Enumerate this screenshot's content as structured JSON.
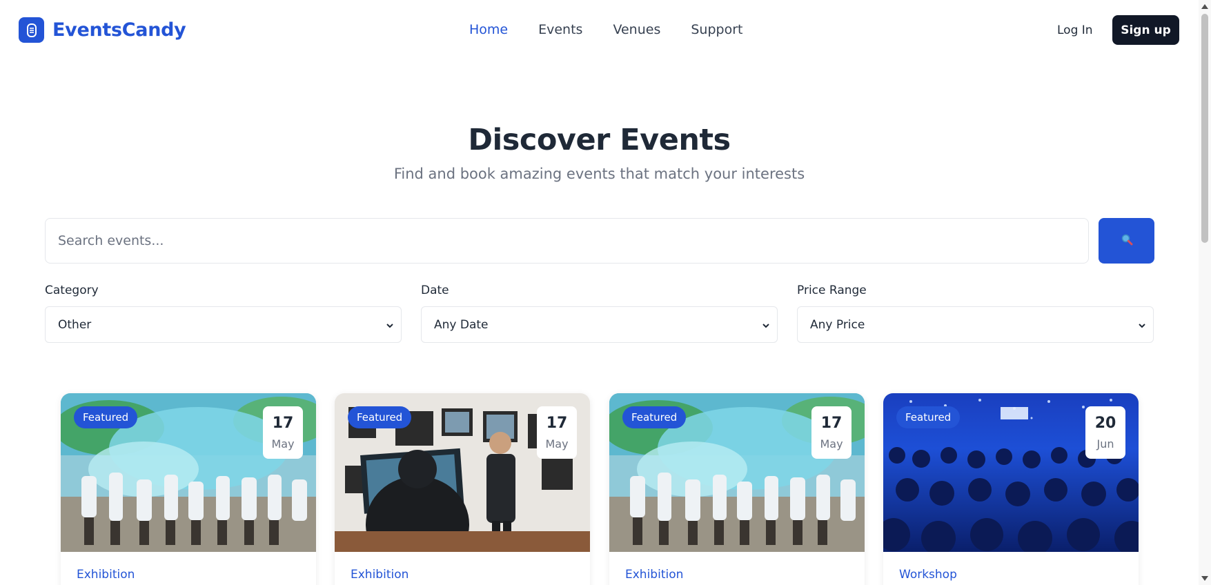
{
  "brand": {
    "name": "EventsCandy",
    "logo_icon": "candy-icon",
    "color": "#2354d6"
  },
  "nav": {
    "items": [
      {
        "label": "Home",
        "active": true
      },
      {
        "label": "Events",
        "active": false
      },
      {
        "label": "Venues",
        "active": false
      },
      {
        "label": "Support",
        "active": false
      }
    ],
    "login_label": "Log In",
    "signup_label": "Sign up"
  },
  "hero": {
    "title": "Discover Events",
    "subtitle": "Find and book amazing events that match your interests"
  },
  "search": {
    "placeholder": "Search events...",
    "button_icon": "search-icon"
  },
  "filters": {
    "category": {
      "label": "Category",
      "value": "Other"
    },
    "date": {
      "label": "Date",
      "value": "Any Date"
    },
    "price": {
      "label": "Price Range",
      "value": "Any Price"
    }
  },
  "events": [
    {
      "badge": "Featured",
      "day": "17",
      "month": "May",
      "category": "Exhibition",
      "image": "color-festival-crowd"
    },
    {
      "badge": "Featured",
      "day": "17",
      "month": "May",
      "category": "Exhibition",
      "image": "photo-gallery-talk"
    },
    {
      "badge": "Featured",
      "day": "17",
      "month": "May",
      "category": "Exhibition",
      "image": "color-festival-crowd"
    },
    {
      "badge": "Featured",
      "day": "20",
      "month": "Jun",
      "category": "Workshop",
      "image": "concert-audience"
    }
  ]
}
